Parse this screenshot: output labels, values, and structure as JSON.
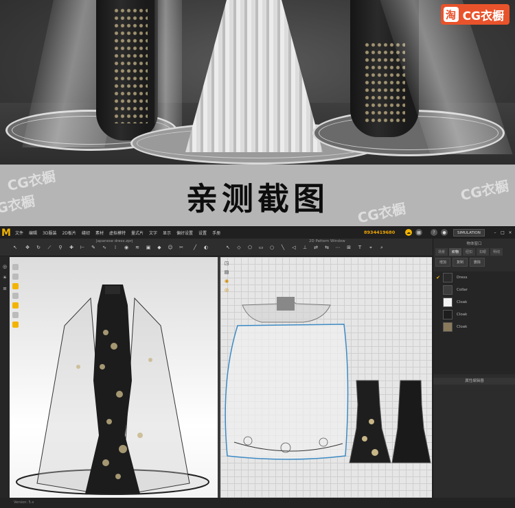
{
  "brand": {
    "icon_char": "淘",
    "name": "CG衣橱"
  },
  "band": {
    "heading": "亲测截图",
    "watermark": "CG衣橱"
  },
  "menubar": {
    "logo": "M",
    "items": [
      "文件",
      "编辑",
      "3D服装",
      "2D板片",
      "缝纫",
      "素材",
      "虚拟模特",
      "量式片",
      "文字",
      "显示",
      "偏好设置",
      "设置",
      "手册"
    ],
    "user_id": "8934419680",
    "simulation": "SIMULATION"
  },
  "windows": {
    "left_title": "Japanese dress.zprj",
    "right_title": "2D Pattern Window"
  },
  "right_panel": {
    "title": "物体窗口",
    "tabs": [
      "场景",
      "织物",
      "纽扣",
      "扣眼",
      "明线"
    ],
    "buttons": [
      "增加",
      "复制",
      "删除"
    ],
    "fabrics": [
      {
        "name": "Dress",
        "color": "#2a2a2a",
        "checked": true
      },
      {
        "name": "Collar",
        "color": "#3c3c3c",
        "checked": false
      },
      {
        "name": "Cloak",
        "color": "#f2f2f2",
        "checked": false
      },
      {
        "name": "Cloak",
        "color": "#1e1e1e",
        "checked": false
      },
      {
        "name": "Cloak",
        "color": "#8a7a5c",
        "checked": false
      }
    ],
    "props_title": "属性编辑器"
  },
  "status": {
    "text": "Version: 5.x"
  }
}
